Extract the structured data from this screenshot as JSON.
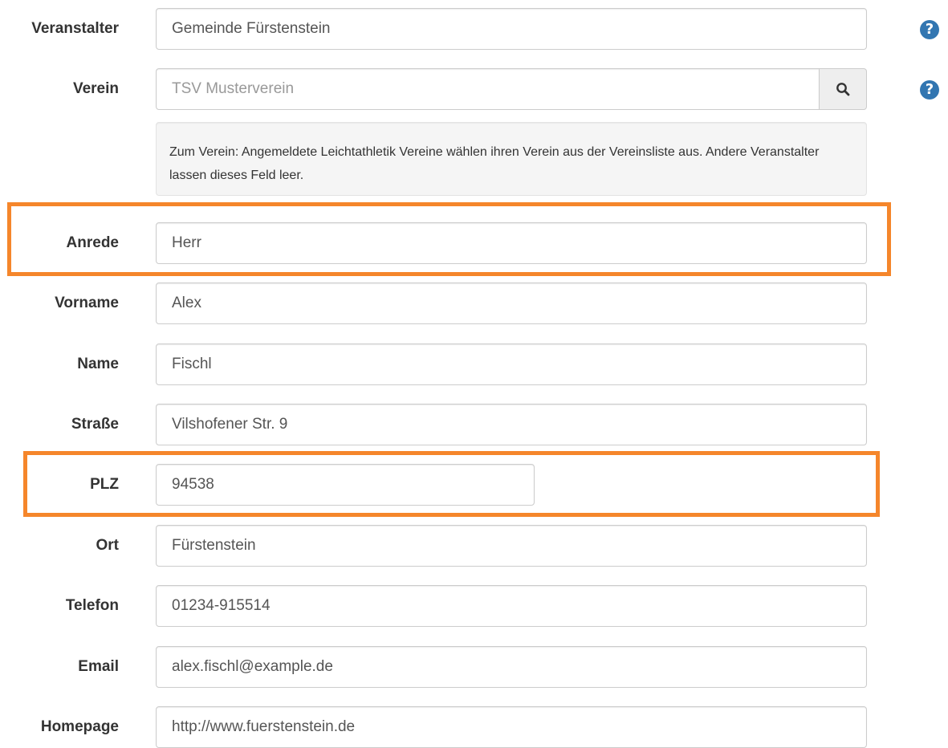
{
  "fields": {
    "veranstalter": {
      "label": "Veranstalter",
      "value": "Gemeinde Fürstenstein"
    },
    "verein": {
      "label": "Verein",
      "value": "",
      "placeholder": "TSV Musterverein"
    },
    "verein_help_text": "Zum Verein: Angemeldete Leichtathletik Vereine wählen ihren Verein aus der Vereinsliste aus. Andere Veranstalter lassen dieses Feld leer.",
    "anrede": {
      "label": "Anrede",
      "value": "Herr"
    },
    "vorname": {
      "label": "Vorname",
      "value": "Alex"
    },
    "name": {
      "label": "Name",
      "value": "Fischl"
    },
    "strasse": {
      "label": "Straße",
      "value": "Vilshofener Str. 9"
    },
    "plz": {
      "label": "PLZ",
      "value": "94538"
    },
    "ort": {
      "label": "Ort",
      "value": "Fürstenstein"
    },
    "telefon": {
      "label": "Telefon",
      "value": "01234-915514"
    },
    "email": {
      "label": "Email",
      "value": "alex.fischl@example.de"
    },
    "homepage": {
      "label": "Homepage",
      "value": "http://www.fuerstenstein.de"
    }
  },
  "icons": {
    "help": "question-circle-icon",
    "search": "search-icon",
    "help_glyph": "?"
  },
  "colors": {
    "highlight": "#f5862b",
    "help_icon": "#3276b1"
  }
}
